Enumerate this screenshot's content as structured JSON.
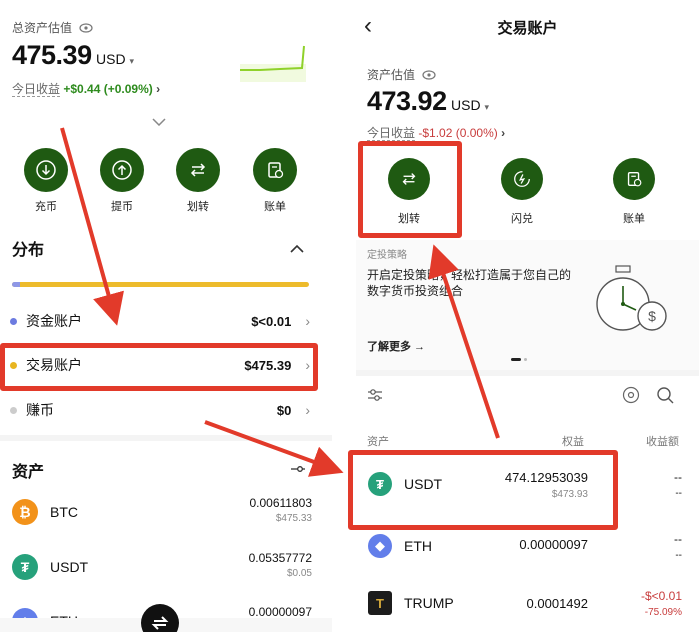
{
  "left": {
    "total_label": "总资产估值",
    "total_value": "475.39",
    "currency": "USD",
    "currency_arrow": "▾",
    "today_label": "今日收益",
    "today_value": "+$0.44 (+0.09%)",
    "today_arrow": "›",
    "actions": [
      {
        "label": "充币",
        "icon": "deposit-icon"
      },
      {
        "label": "提币",
        "icon": "withdraw-icon"
      },
      {
        "label": "划转",
        "icon": "transfer-icon"
      },
      {
        "label": "账单",
        "icon": "bill-icon"
      }
    ],
    "distribution_title": "分布",
    "accounts": [
      {
        "label": "资金账户",
        "value": "$<0.01",
        "color": "#6c7be0"
      },
      {
        "label": "交易账户",
        "value": "$475.39",
        "color": "#e8b520"
      },
      {
        "label": "赚币",
        "value": "$0",
        "color": "#cccccc"
      }
    ],
    "assets_title": "资产",
    "coins": [
      {
        "name": "BTC",
        "amount": "0.00611803",
        "usd": "$475.33",
        "color": "#f2921a",
        "glyph": "₿"
      },
      {
        "name": "USDT",
        "amount": "0.05357772",
        "usd": "$0.05",
        "color": "#26a17b",
        "glyph": "₮"
      },
      {
        "name": "ETH",
        "amount": "0.00000097",
        "usd": "",
        "color": "#627eea",
        "glyph": "◆"
      }
    ]
  },
  "right": {
    "title": "交易账户",
    "back": "‹",
    "est_label": "资产估值",
    "est_value": "473.92",
    "currency": "USD",
    "currency_arrow": "▾",
    "today_label": "今日收益",
    "today_value": "-$1.02 (0.00%)",
    "today_arrow": "›",
    "actions": [
      {
        "label": "划转",
        "icon": "transfer-icon"
      },
      {
        "label": "闪兑",
        "icon": "flash-swap-icon"
      },
      {
        "label": "账单",
        "icon": "bill-icon"
      }
    ],
    "promo_tag": "定投策略",
    "promo_text_1": "开启定投策略，轻松打造属于您自己的",
    "promo_text_2": "数字货币投资组合",
    "promo_link": "了解更多 →",
    "col_asset": "资产",
    "col_equity": "权益",
    "col_pnl": "收益额",
    "coins": [
      {
        "name": "USDT",
        "qty": "474.12953039",
        "usd": "$473.93",
        "pnl": "--",
        "pnl2": "--",
        "color": "#26a17b",
        "glyph": "₮"
      },
      {
        "name": "ETH",
        "qty": "0.00000097",
        "usd": "",
        "pnl": "--",
        "pnl2": "--",
        "color": "#627eea",
        "glyph": "◆"
      },
      {
        "name": "TRUMP",
        "qty": "0.0001492",
        "usd": "",
        "pnl": "-$<0.01",
        "pnl2": "-75.09%",
        "color": "#1c1c1c",
        "glyph": "T"
      }
    ]
  }
}
